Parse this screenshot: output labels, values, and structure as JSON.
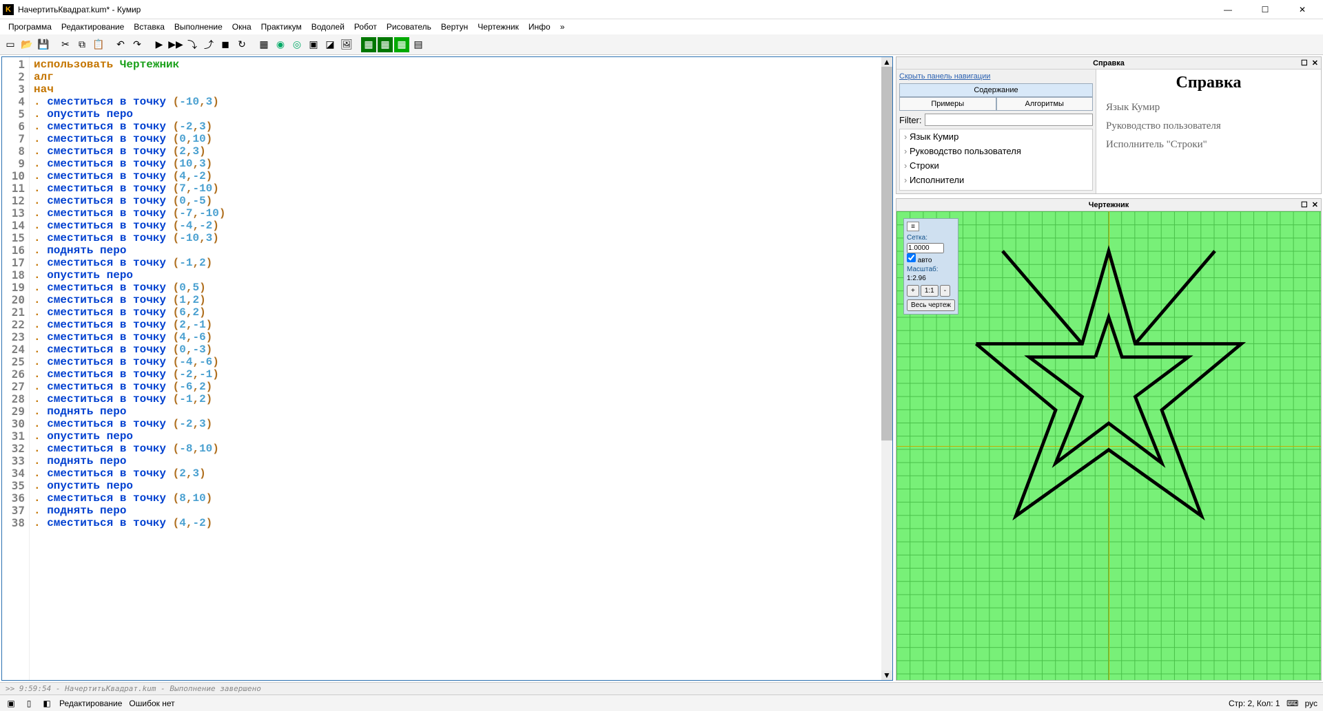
{
  "window": {
    "title": "НачертитьКвадрат.kum* - Кумир"
  },
  "menus": [
    "Программа",
    "Редактирование",
    "Вставка",
    "Выполнение",
    "Окна",
    "Практикум",
    "Водолей",
    "Робот",
    "Рисователь",
    "Вертун",
    "Чертежник",
    "Инфо",
    "»"
  ],
  "code": {
    "lines": [
      {
        "n": 1,
        "t": "use",
        "use_kw": "использовать",
        "use_mod": "Чертежник"
      },
      {
        "n": 2,
        "t": "kw",
        "text": "алг"
      },
      {
        "n": 3,
        "t": "kw",
        "text": "нач"
      },
      {
        "n": 4,
        "t": "mv",
        "x": "-10",
        "y": "3"
      },
      {
        "n": 5,
        "t": "cmd",
        "text": "опустить перо"
      },
      {
        "n": 6,
        "t": "mv",
        "x": "-2",
        "y": "3"
      },
      {
        "n": 7,
        "t": "mv",
        "x": "0",
        "y": "10"
      },
      {
        "n": 8,
        "t": "mv",
        "x": "2",
        "y": "3"
      },
      {
        "n": 9,
        "t": "mv",
        "x": "10",
        "y": "3"
      },
      {
        "n": 10,
        "t": "mv",
        "x": "4",
        "y": "-2"
      },
      {
        "n": 11,
        "t": "mv",
        "x": "7",
        "y": "-10"
      },
      {
        "n": 12,
        "t": "mv",
        "x": "0",
        "y": "-5"
      },
      {
        "n": 13,
        "t": "mv",
        "x": "-7",
        "y": "-10"
      },
      {
        "n": 14,
        "t": "mv",
        "x": "-4",
        "y": "-2"
      },
      {
        "n": 15,
        "t": "mv",
        "x": "-10",
        "y": "3"
      },
      {
        "n": 16,
        "t": "cmd",
        "text": "поднять перо"
      },
      {
        "n": 17,
        "t": "mv",
        "x": "-1",
        "y": "2"
      },
      {
        "n": 18,
        "t": "cmd",
        "text": "опустить перо"
      },
      {
        "n": 19,
        "t": "mv",
        "x": "0",
        "y": "5"
      },
      {
        "n": 20,
        "t": "mv",
        "x": "1",
        "y": "2"
      },
      {
        "n": 21,
        "t": "mv",
        "x": "6",
        "y": "2"
      },
      {
        "n": 22,
        "t": "mv",
        "x": "2",
        "y": "-1"
      },
      {
        "n": 23,
        "t": "mv",
        "x": "4",
        "y": "-6"
      },
      {
        "n": 24,
        "t": "mv",
        "x": "0",
        "y": "-3"
      },
      {
        "n": 25,
        "t": "mv",
        "x": "-4",
        "y": "-6"
      },
      {
        "n": 26,
        "t": "mv",
        "x": "-2",
        "y": "-1"
      },
      {
        "n": 27,
        "t": "mv",
        "x": "-6",
        "y": "2"
      },
      {
        "n": 28,
        "t": "mv",
        "x": "-1",
        "y": "2"
      },
      {
        "n": 29,
        "t": "cmd",
        "text": "поднять перо"
      },
      {
        "n": 30,
        "t": "mv",
        "x": "-2",
        "y": "3"
      },
      {
        "n": 31,
        "t": "cmd",
        "text": "опустить перо"
      },
      {
        "n": 32,
        "t": "mv",
        "x": "-8",
        "y": "10"
      },
      {
        "n": 33,
        "t": "cmd",
        "text": "поднять перо"
      },
      {
        "n": 34,
        "t": "mv",
        "x": "2",
        "y": "3"
      },
      {
        "n": 35,
        "t": "cmd",
        "text": "опустить перо"
      },
      {
        "n": 36,
        "t": "mv",
        "x": "8",
        "y": "10"
      },
      {
        "n": 37,
        "t": "cmd",
        "text": "поднять перо"
      },
      {
        "n": 38,
        "t": "mv",
        "x": "4",
        "y": "-2"
      }
    ],
    "move_cmd": "сместиться в точку"
  },
  "help": {
    "panel_title": "Справка",
    "hide_nav": "Скрыть панель навигации",
    "tabs": {
      "content": "Содержание",
      "examples": "Примеры",
      "algorithms": "Алгоритмы"
    },
    "filter_label": "Filter:",
    "tree": [
      "Язык Кумир",
      "Руководство пользователя",
      "Строки",
      "Исполнители"
    ],
    "content_title": "Справка",
    "content_items": [
      "Язык Кумир",
      "Руководство пользователя",
      "Исполнитель \"Строки\""
    ]
  },
  "draw": {
    "panel_title": "Чертежник",
    "grid_label": "Сетка:",
    "grid_value": "1.0000",
    "auto": "авто",
    "scale_label": "Масштаб:",
    "scale_value": "1:2.96",
    "btn_plus": "+",
    "btn_11": "1:1",
    "btn_minus": "-",
    "btn_fit": "Весь чертеж"
  },
  "console": ">>  9:59:54 - НачертитьКвадрат.kum - Выполнение завершено",
  "status": {
    "mode": "Редактирование",
    "errors": "Ошибок нет",
    "pos": "Стр: 2, Кол: 1",
    "lang": "рус"
  },
  "chart_data": {
    "type": "line",
    "title": "Чертежник",
    "paths": [
      {
        "pen": true,
        "points": [
          [
            -10,
            3
          ],
          [
            -2,
            3
          ],
          [
            0,
            10
          ],
          [
            2,
            3
          ],
          [
            10,
            3
          ],
          [
            4,
            -2
          ],
          [
            7,
            -10
          ],
          [
            0,
            -5
          ],
          [
            -7,
            -10
          ],
          [
            -4,
            -2
          ],
          [
            -10,
            3
          ]
        ]
      },
      {
        "pen": true,
        "points": [
          [
            -1,
            2
          ],
          [
            0,
            5
          ],
          [
            1,
            2
          ],
          [
            6,
            2
          ],
          [
            2,
            -1
          ],
          [
            4,
            -6
          ],
          [
            0,
            -3
          ],
          [
            -4,
            -6
          ],
          [
            -2,
            -1
          ],
          [
            -6,
            2
          ],
          [
            -1,
            2
          ]
        ]
      },
      {
        "pen": true,
        "points": [
          [
            -2,
            3
          ],
          [
            -8,
            10
          ]
        ]
      },
      {
        "pen": true,
        "points": [
          [
            2,
            3
          ],
          [
            8,
            10
          ]
        ]
      }
    ],
    "xrange": [
      -16,
      16
    ],
    "yrange": [
      -13,
      13
    ]
  }
}
